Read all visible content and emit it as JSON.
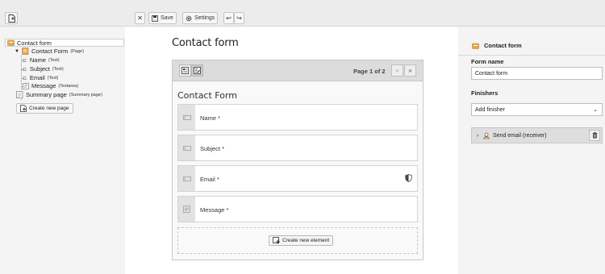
{
  "toolbar": {
    "save_label": "Save",
    "settings_label": "Settings"
  },
  "tree": {
    "root": "Contact form",
    "page": {
      "label": "Contact Form",
      "type": "(Page)"
    },
    "elements": [
      {
        "label": "Name",
        "type": "(Text)"
      },
      {
        "label": "Subject",
        "type": "(Text)"
      },
      {
        "label": "Email",
        "type": "(Text)"
      },
      {
        "label": "Message",
        "type": "(Textarea)"
      }
    ],
    "summary": {
      "label": "Summary page",
      "type": "(Summary page)"
    },
    "create_page_label": "Create new page"
  },
  "stage": {
    "title": "Contact form",
    "pager": "Page 1 of 2",
    "prev_icon": "«",
    "next_icon": "»",
    "form_heading": "Contact Form",
    "fields": [
      {
        "label": "Name *",
        "icon": "text-field-icon"
      },
      {
        "label": "Subject *",
        "icon": "text-field-icon"
      },
      {
        "label": "Email *",
        "icon": "text-field-icon",
        "validator": "shield-icon"
      },
      {
        "label": "Message *",
        "icon": "textarea-icon"
      }
    ],
    "create_element_label": "Create new element"
  },
  "inspector": {
    "header": "Contact form",
    "form_name_label": "Form name",
    "form_name_value": "Contact form",
    "finishers_label": "Finishers",
    "add_finisher_placeholder": "Add finisher",
    "finisher_item": "Send email (receiver)"
  },
  "colors": {
    "form_icon": "#e8a54b",
    "toolbar_bg": "#ececec",
    "panel_bg": "#f4f4f4"
  }
}
